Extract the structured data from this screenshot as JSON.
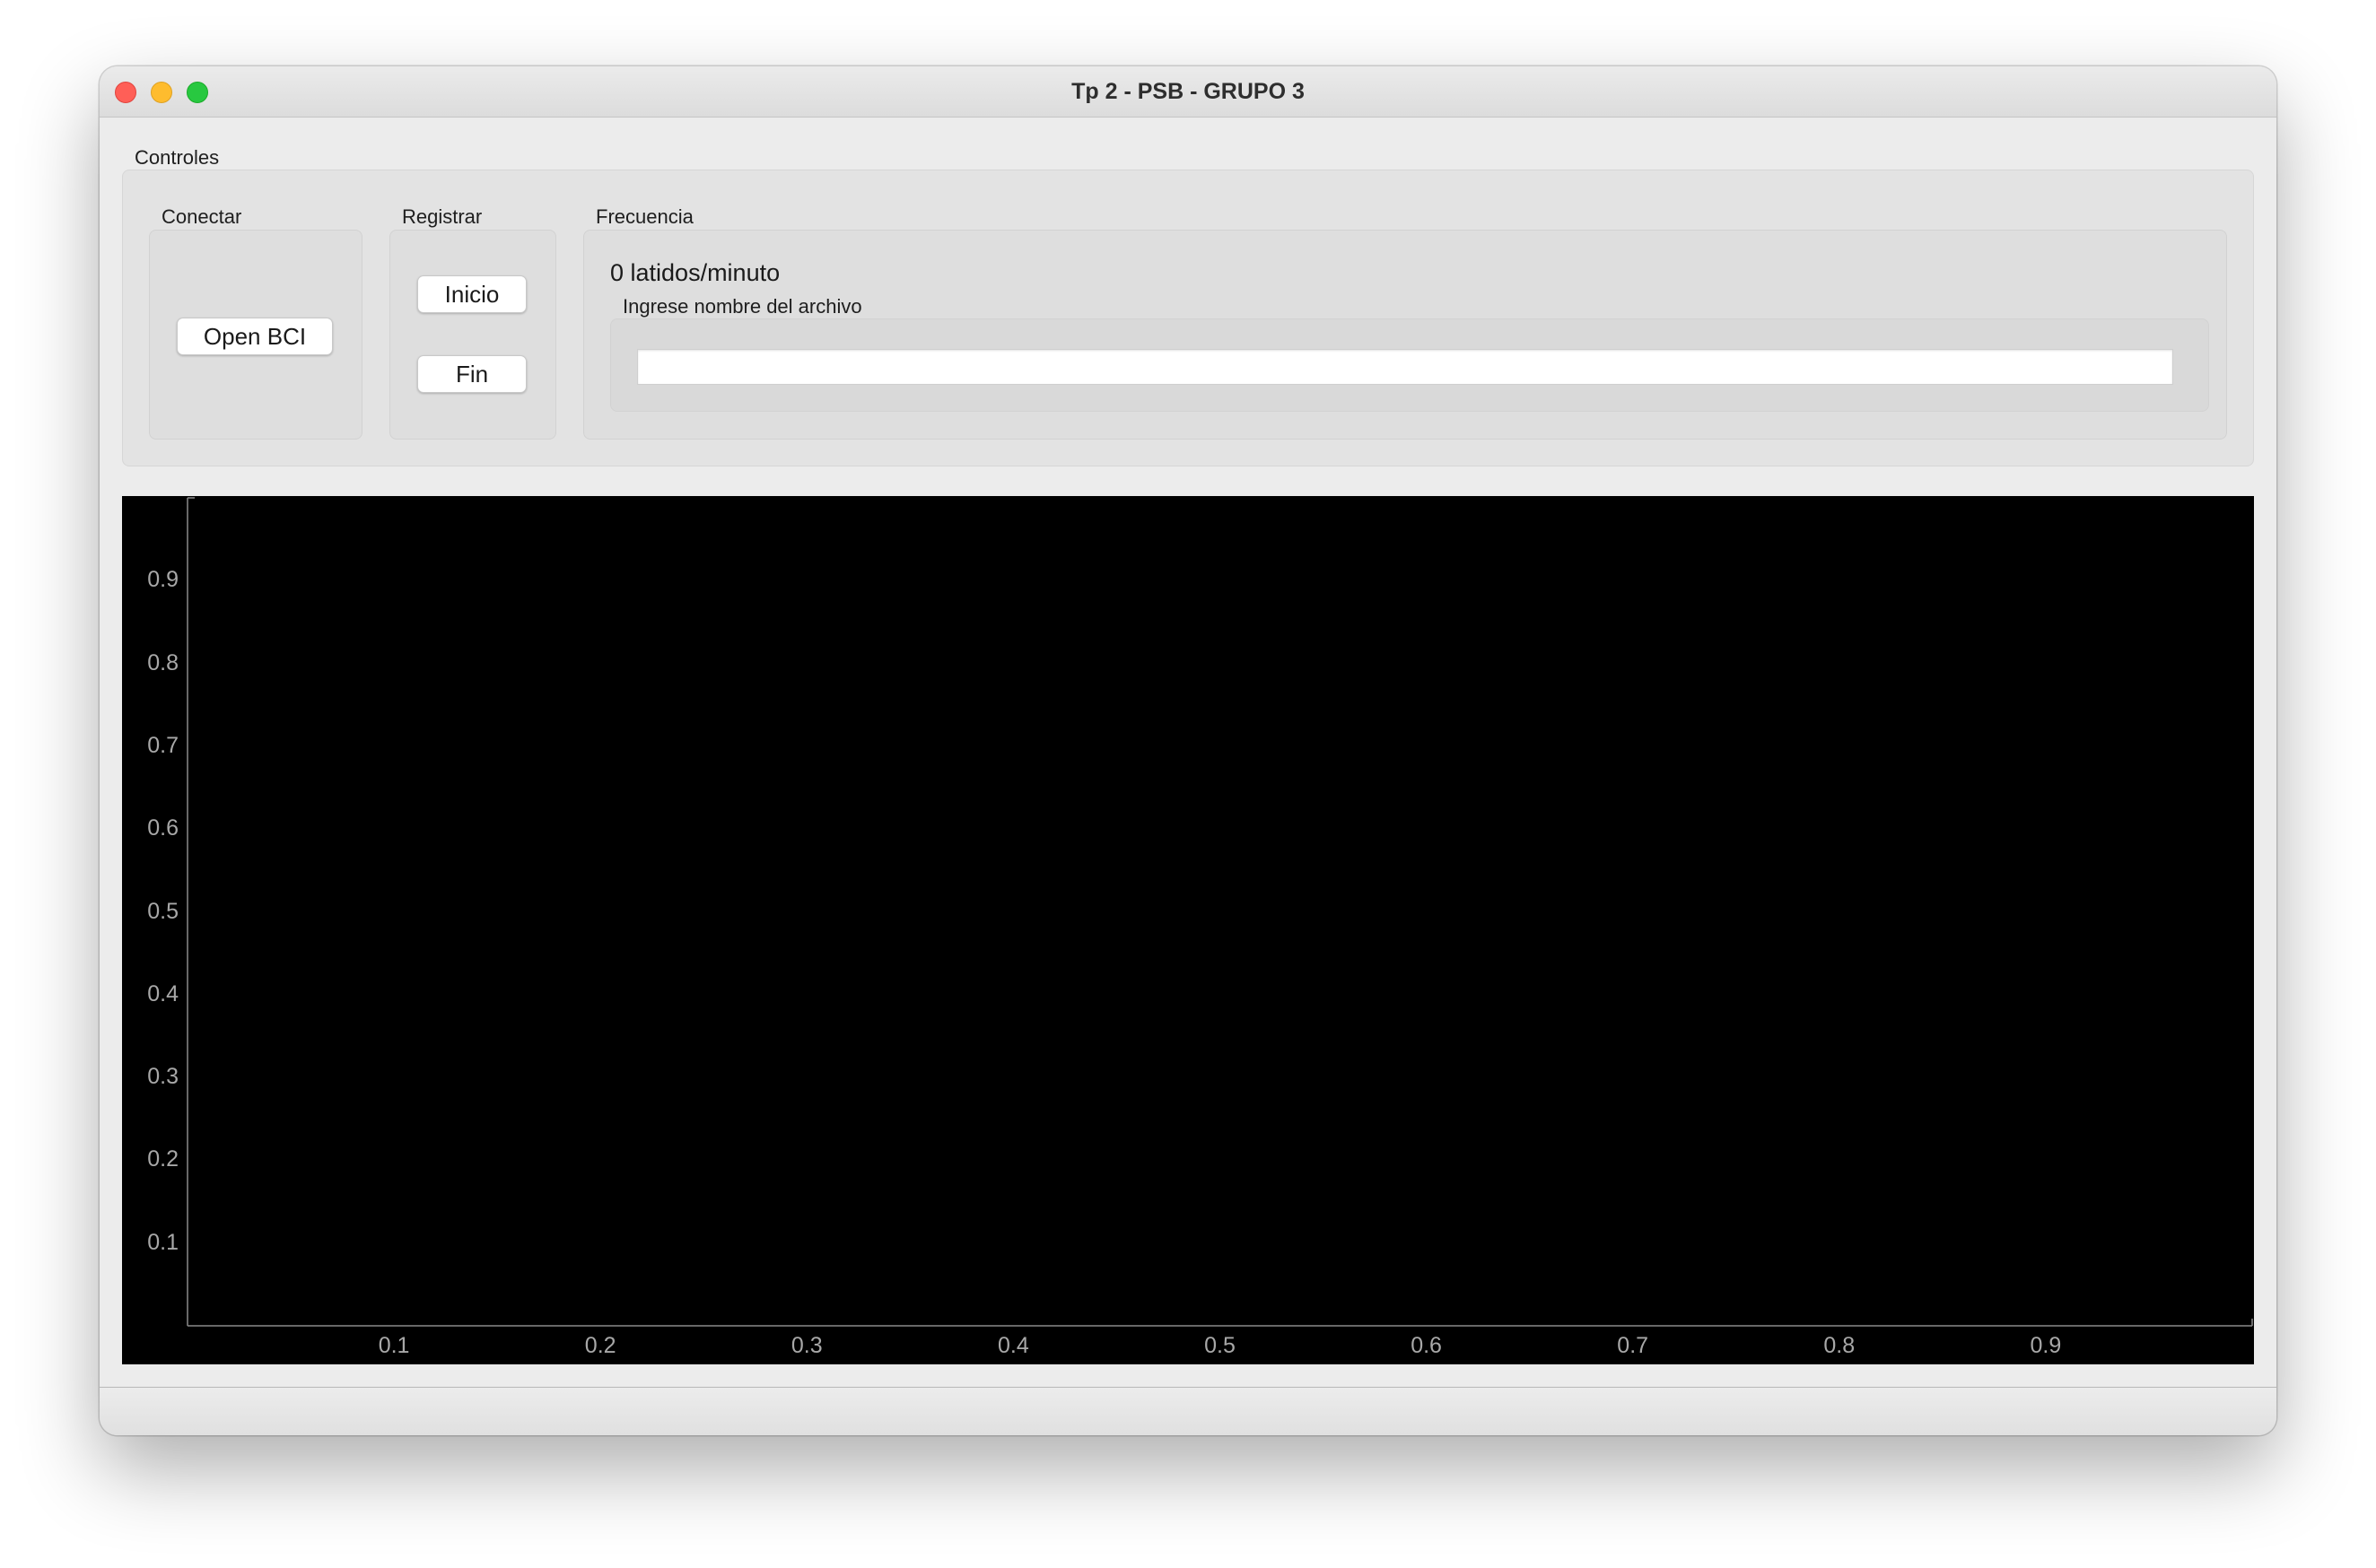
{
  "window": {
    "title": "Tp 2 - PSB - GRUPO 3",
    "traffic_lights": {
      "close": "#ff5f57",
      "minimize": "#febc2e",
      "zoom": "#28c840"
    }
  },
  "controls": {
    "label": "Controles",
    "conectar": {
      "label": "Conectar",
      "button": "Open BCI"
    },
    "registrar": {
      "label": "Registrar",
      "start_button": "Inicio",
      "end_button": "Fin"
    },
    "frecuencia": {
      "label": "Frecuencia",
      "value_text": "0 latidos/minuto",
      "file_label": "Ingrese nombre del archivo",
      "file_value": ""
    }
  },
  "plot": {
    "background": "#000000",
    "y_ticks": [
      "0.1",
      "0.2",
      "0.3",
      "0.4",
      "0.5",
      "0.6",
      "0.7",
      "0.8",
      "0.9"
    ],
    "x_ticks": [
      "0.1",
      "0.2",
      "0.3",
      "0.4",
      "0.5",
      "0.6",
      "0.7",
      "0.8",
      "0.9"
    ]
  }
}
